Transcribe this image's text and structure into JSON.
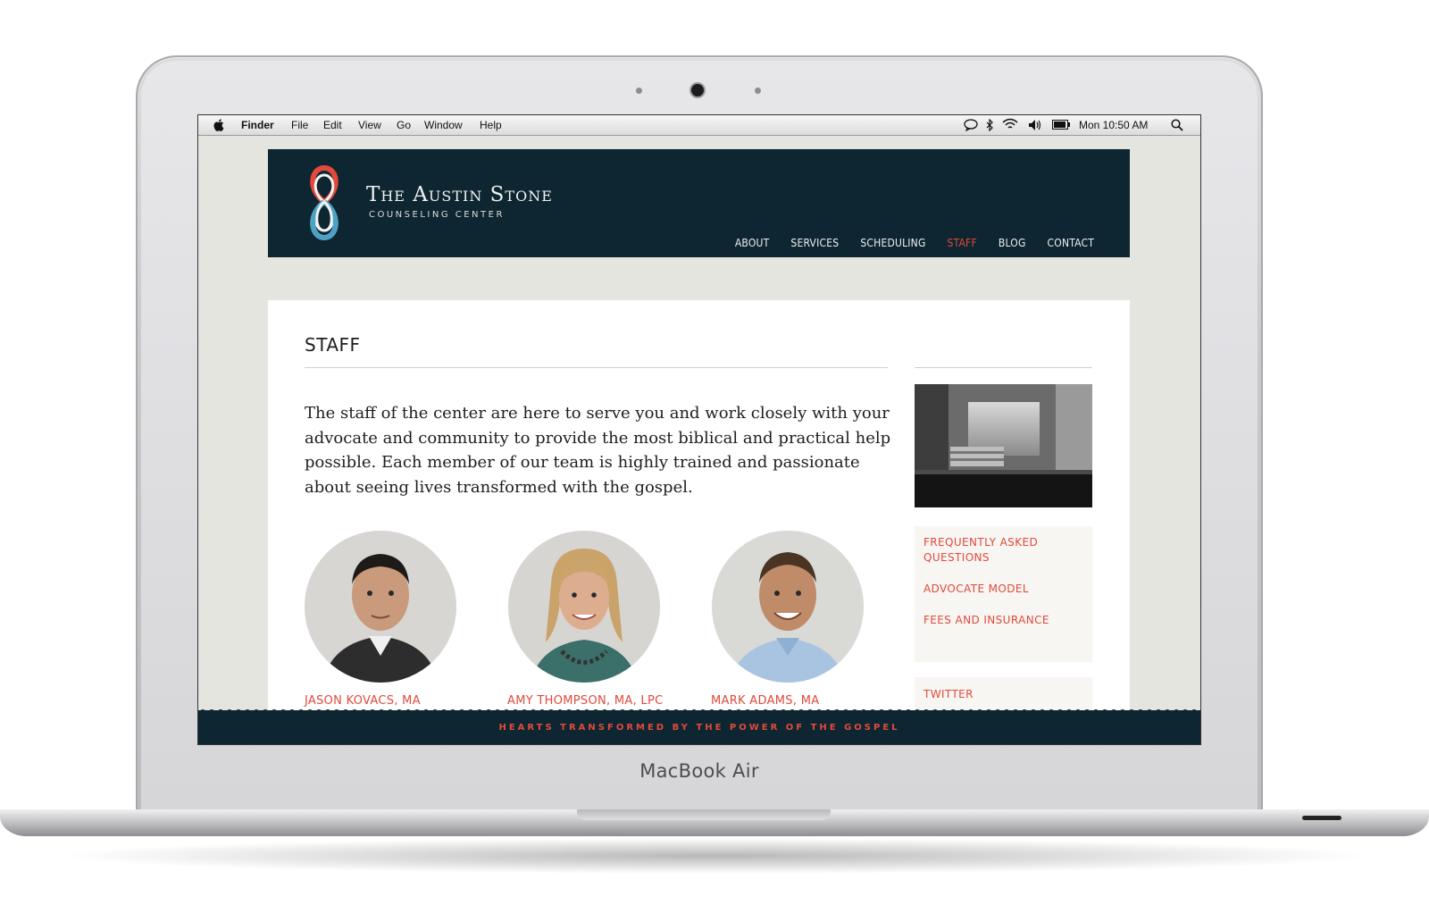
{
  "device": {
    "brand": "MacBook Air"
  },
  "menubar": {
    "app": "Finder",
    "menus": [
      "File",
      "Edit",
      "View",
      "Go",
      "Window",
      "Help"
    ],
    "clock": "Mon 10:50 AM",
    "status_icons": [
      "chat-icon",
      "bluetooth-icon",
      "wifi-icon",
      "volume-icon",
      "battery-icon",
      "spotlight-icon"
    ]
  },
  "site": {
    "title": "The Austin Stone",
    "subtitle": "COUNSELING CENTER",
    "nav": [
      "ABOUT",
      "SERVICES",
      "SCHEDULING",
      "STAFF",
      "BLOG",
      "CONTACT"
    ],
    "active_nav": "STAFF"
  },
  "page": {
    "title": "STAFF",
    "intro": "The staff of the center are here to serve you and work closely with your advocate and community to provide the most biblical and practical help possible. Each member of our team is highly trained and passionate about seeing lives transformed with the gospel."
  },
  "staff": [
    {
      "name": "JASON KOVACS, MA"
    },
    {
      "name": "AMY THOMPSON, MA, LPC"
    },
    {
      "name": "MARK ADAMS, MA"
    }
  ],
  "sidebar": {
    "links": [
      "FREQUENTLY ASKED QUESTIONS",
      "ADVOCATE MODEL",
      "FEES AND INSURANCE"
    ],
    "twitter": "TWITTER"
  },
  "footer": {
    "tagline": "HEARTS TRANSFORMED BY THE POWER OF THE GOSPEL"
  },
  "colors": {
    "navy": "#0d2631",
    "accent": "#e2493b",
    "page_bg": "#e5e5df"
  }
}
